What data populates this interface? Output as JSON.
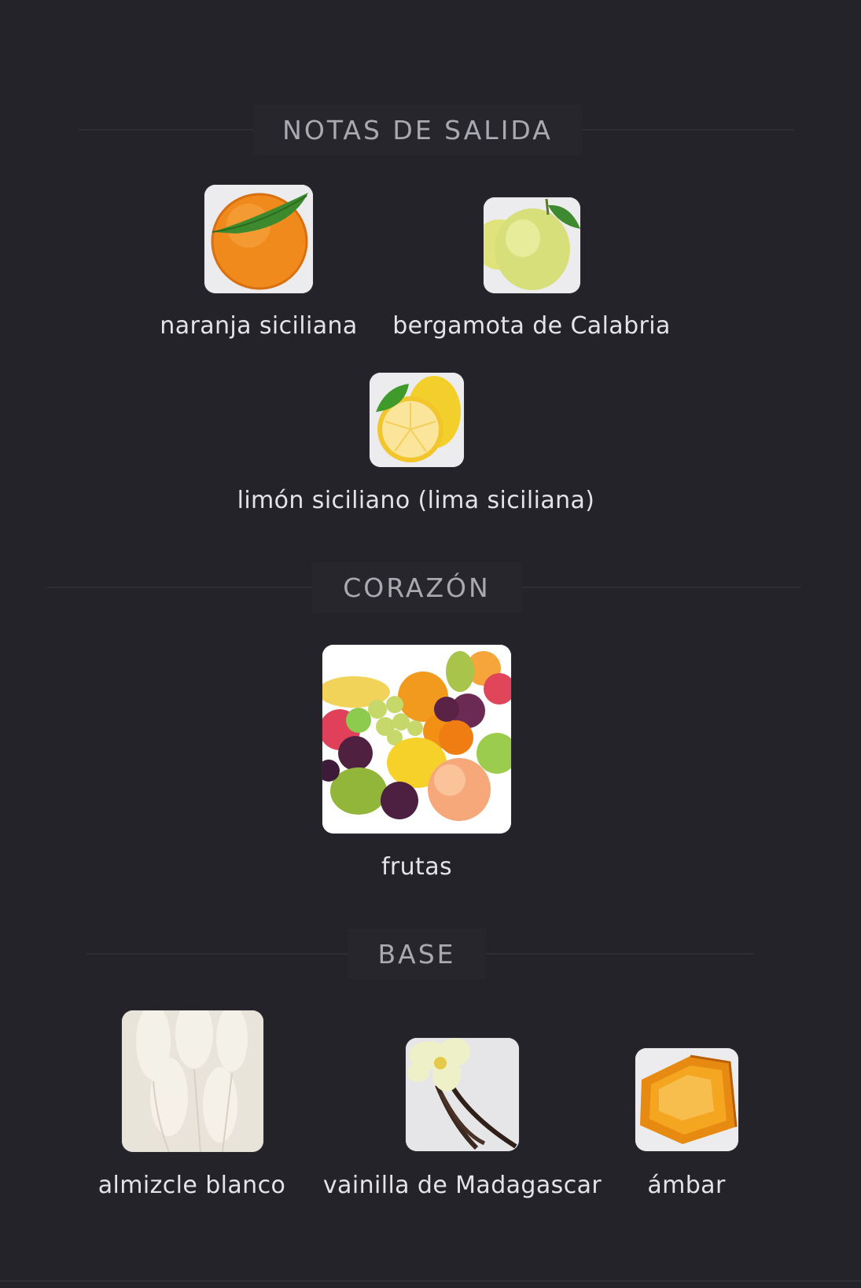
{
  "sections": {
    "top": {
      "title": "NOTAS DE SALIDA",
      "notes": [
        {
          "label": "naranja siciliana",
          "icon": "orange-image"
        },
        {
          "label": "bergamota de Calabria",
          "icon": "bergamot-image"
        },
        {
          "label": "limón siciliano (lima siciliana)",
          "icon": "lemon-image"
        }
      ]
    },
    "heart": {
      "title": "CORAZÓN",
      "notes": [
        {
          "label": "frutas",
          "icon": "fruits-image"
        }
      ]
    },
    "base": {
      "title": "BASE",
      "notes": [
        {
          "label": "almizcle blanco",
          "icon": "white-musk-image"
        },
        {
          "label": "vainilla de Madagascar",
          "icon": "vanilla-image"
        },
        {
          "label": "ámbar",
          "icon": "amber-image"
        }
      ]
    }
  },
  "colors": {
    "background": "#232329",
    "header_text": "#a9a9b0",
    "label_text": "#e4e4e8"
  }
}
